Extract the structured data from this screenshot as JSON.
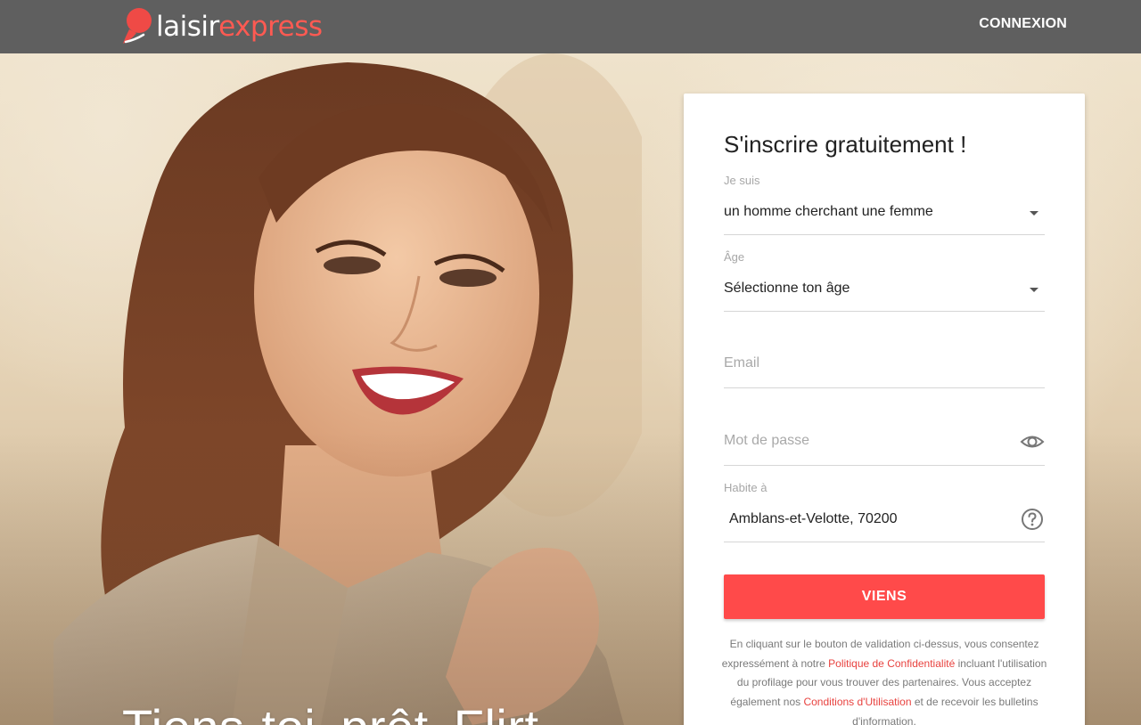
{
  "header": {
    "logo_part1": "laisir",
    "logo_part2": "express",
    "login_label": "CONNEXION"
  },
  "hero": {
    "tagline": "Tiens-toi prêt  Flirt"
  },
  "form": {
    "title": "S'inscrire gratuitement !",
    "gender_label": "Je suis",
    "gender_value": "un homme cherchant une femme",
    "age_label": "Âge",
    "age_value": "Sélectionne ton âge",
    "email_placeholder": "Email",
    "password_placeholder": "Mot de passe",
    "city_label": "Habite à",
    "city_value": "Amblans-et-Velotte, 70200",
    "submit_label": "VIENS",
    "legal_text_1": "En cliquant sur le bouton de validation ci-dessus, vous consentez expressément à notre ",
    "legal_link_privacy": "Politique de Confidentialité",
    "legal_text_2": " incluant l'utilisation du profilage pour vous trouver des partenaires. Vous acceptez également nos ",
    "legal_link_terms": "Conditions d'Utilisation",
    "legal_text_3": " et de recevoir les bulletins d'information."
  },
  "colors": {
    "header_bg": "#5f5f5f",
    "brand_accent": "#ff5a52",
    "button_bg": "#ff4a4a",
    "link": "#e8423f"
  },
  "icons": {
    "logo_mark": "speech-bubble-logo-icon",
    "gender_caret": "chevron-down-icon",
    "age_caret": "chevron-down-icon",
    "password_toggle": "eye-icon",
    "city_help": "help-circle-icon"
  }
}
